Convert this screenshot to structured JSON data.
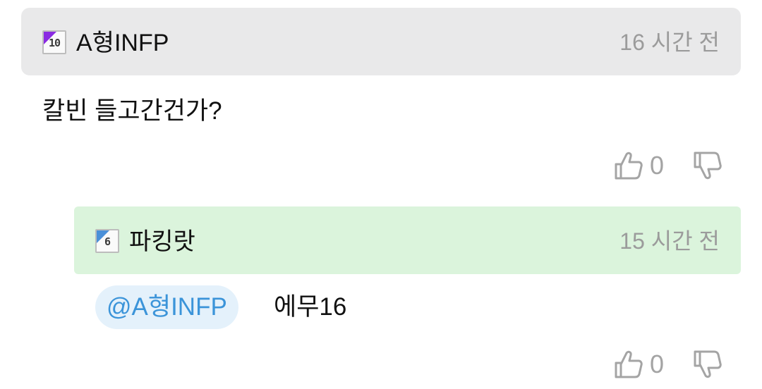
{
  "comment": {
    "badge_level": "10",
    "badge_color": "#8a2be2",
    "username": "A형INFP",
    "timestamp": "16 시간 전",
    "body": "칼빈 들고간건가?",
    "likes": "0"
  },
  "reply": {
    "badge_level": "6",
    "badge_color": "#4a90d9",
    "username": "파킹랏",
    "timestamp": "15 시간 전",
    "mention": "@A형INFP",
    "body": "에무16",
    "likes": "0"
  },
  "colors": {
    "comment_header_bg": "#e9e9ea",
    "reply_header_bg": "#dbf4dc",
    "mention_bg": "#e4f1fb",
    "mention_text": "#3b94d9",
    "muted_text": "#9b9b9b"
  },
  "icons": [
    "thumbs-up-icon",
    "thumbs-down-icon"
  ]
}
